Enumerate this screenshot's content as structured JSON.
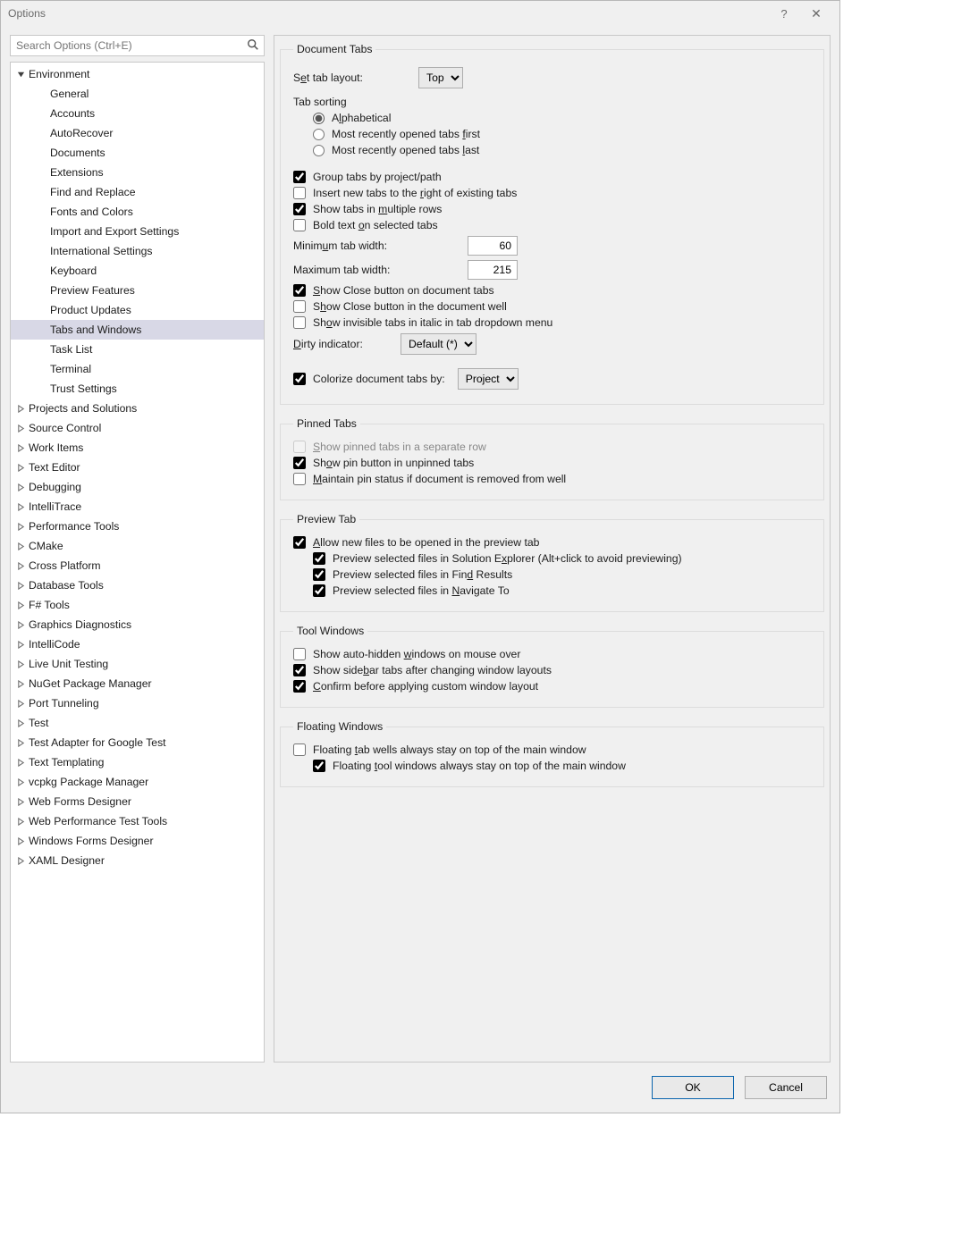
{
  "title": "Options",
  "search_placeholder": "Search Options (Ctrl+E)",
  "tree": {
    "environment": "Environment",
    "env_children": [
      "General",
      "Accounts",
      "AutoRecover",
      "Documents",
      "Extensions",
      "Find and Replace",
      "Fonts and Colors",
      "Import and Export Settings",
      "International Settings",
      "Keyboard",
      "Preview Features",
      "Product Updates",
      "Tabs and Windows",
      "Task List",
      "Terminal",
      "Trust Settings"
    ],
    "selected": "Tabs and Windows",
    "collapsed": [
      "Projects and Solutions",
      "Source Control",
      "Work Items",
      "Text Editor",
      "Debugging",
      "IntelliTrace",
      "Performance Tools",
      "CMake",
      "Cross Platform",
      "Database Tools",
      "F# Tools",
      "Graphics Diagnostics",
      "IntelliCode",
      "Live Unit Testing",
      "NuGet Package Manager",
      "Port Tunneling",
      "Test",
      "Test Adapter for Google Test",
      "Text Templating",
      "vcpkg Package Manager",
      "Web Forms Designer",
      "Web Performance Test Tools",
      "Windows Forms Designer",
      "XAML Designer"
    ]
  },
  "groups": {
    "document_tabs": "Document Tabs",
    "pinned_tabs": "Pinned Tabs",
    "preview_tab": "Preview Tab",
    "tool_windows": "Tool Windows",
    "floating_windows": "Floating Windows"
  },
  "doc": {
    "set_tab_layout_label": "Set tab layout:",
    "set_tab_layout_value": "Top",
    "tab_sorting_label": "Tab sorting",
    "sort_alpha": "Alphabetical",
    "sort_first": "Most recently opened tabs first",
    "sort_last": "Most recently opened tabs last",
    "group_tabs": "Group tabs by project/path",
    "insert_right": "Insert new tabs to the right of existing tabs",
    "multi_row": "Show tabs in multiple rows",
    "bold_selected": "Bold text on selected tabs",
    "min_width_label": "Minimum tab width:",
    "min_width_value": "60",
    "max_width_label": "Maximum tab width:",
    "max_width_value": "215",
    "close_on_tabs": "Show Close button on document tabs",
    "close_in_well": "Show Close button in the document well",
    "invisible_italic": "Show invisible tabs in italic in tab dropdown menu",
    "dirty_label": "Dirty indicator:",
    "dirty_value": "Default (*)",
    "colorize_label": "Colorize document tabs by:",
    "colorize_value": "Project"
  },
  "pinned": {
    "separate_row": "Show pinned tabs in a separate row",
    "pin_button": "Show pin button in unpinned tabs",
    "maintain_pin": "Maintain pin status if document is removed from well"
  },
  "preview": {
    "allow": "Allow new files to be opened in the preview tab",
    "sol_explorer": "Preview selected files in Solution Explorer (Alt+click to avoid previewing)",
    "find_results": "Preview selected files in Find Results",
    "navigate_to": "Preview selected files in Navigate To"
  },
  "tool": {
    "auto_hidden": "Show auto-hidden windows on mouse over",
    "sidebar_tabs": "Show sidebar tabs after changing window layouts",
    "confirm_layout": "Confirm before applying custom window layout"
  },
  "floating": {
    "tab_wells": "Floating tab wells always stay on top of the main window",
    "tool_windows": "Floating tool windows always stay on top of the main window"
  },
  "buttons": {
    "ok": "OK",
    "cancel": "Cancel"
  }
}
